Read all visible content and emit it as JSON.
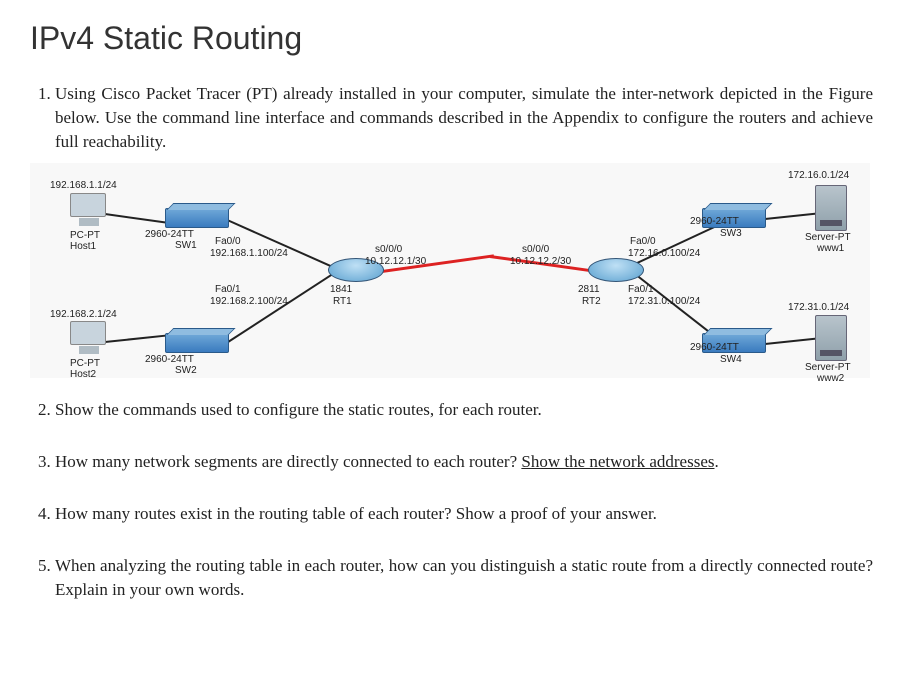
{
  "title": "IPv4 Static Routing",
  "questions": {
    "q1": "Using Cisco Packet Tracer (PT) already installed in your computer, simulate the inter-network depicted in the Figure below. Use the command line interface and commands described in the Appendix to configure the routers and achieve full reachability.",
    "q2": "Show the commands used to configure the static routes, for each router.",
    "q3a": "How many network segments are directly connected to each router? ",
    "q3b": "Show the network addresses",
    "q3c": ".",
    "q4": "How many routes exist in the routing table of each router? Show a proof of your answer.",
    "q5": "When analyzing the routing table in each router, how can you distinguish a static route from a directly connected route? Explain in your own words."
  },
  "diagram": {
    "host1_ip": "192.168.1.1/24",
    "host1_type": "PC-PT",
    "host1_name": "Host1",
    "sw1_model": "2960-24TT",
    "sw1_name": "SW1",
    "rt1_fa00": "Fa0/0",
    "rt1_fa00_ip": "192.168.1.100/24",
    "rt1_fa01": "Fa0/1",
    "rt1_fa01_ip": "192.168.2.100/24",
    "rt1_model": "1841",
    "rt1_name": "RT1",
    "s000_a": "s0/0/0",
    "s000_a_ip": "10.12.12.1/30",
    "s000_b": "s0/0/0",
    "s000_b_ip": "10.12.12.2/30",
    "rt2_model": "2811",
    "rt2_name": "RT2",
    "rt2_fa00": "Fa0/0",
    "rt2_fa00_ip": "172.16.0.100/24",
    "rt2_fa01": "Fa0/1",
    "rt2_fa01_ip": "172.31.0.100/24",
    "sw3_model": "2960-24TT",
    "sw3_name": "SW3",
    "www1_ip": "172.16.0.1/24",
    "www1_type": "Server-PT",
    "www1_name": "www1",
    "host2_ip": "192.168.2.1/24",
    "host2_type": "PC-PT",
    "host2_name": "Host2",
    "sw2_model": "2960-24TT",
    "sw2_name": "SW2",
    "sw4_model": "2960-24TT",
    "sw4_name": "SW4",
    "www2_ip": "172.31.0.1/24",
    "www2_type": "Server-PT",
    "www2_name": "www2"
  }
}
